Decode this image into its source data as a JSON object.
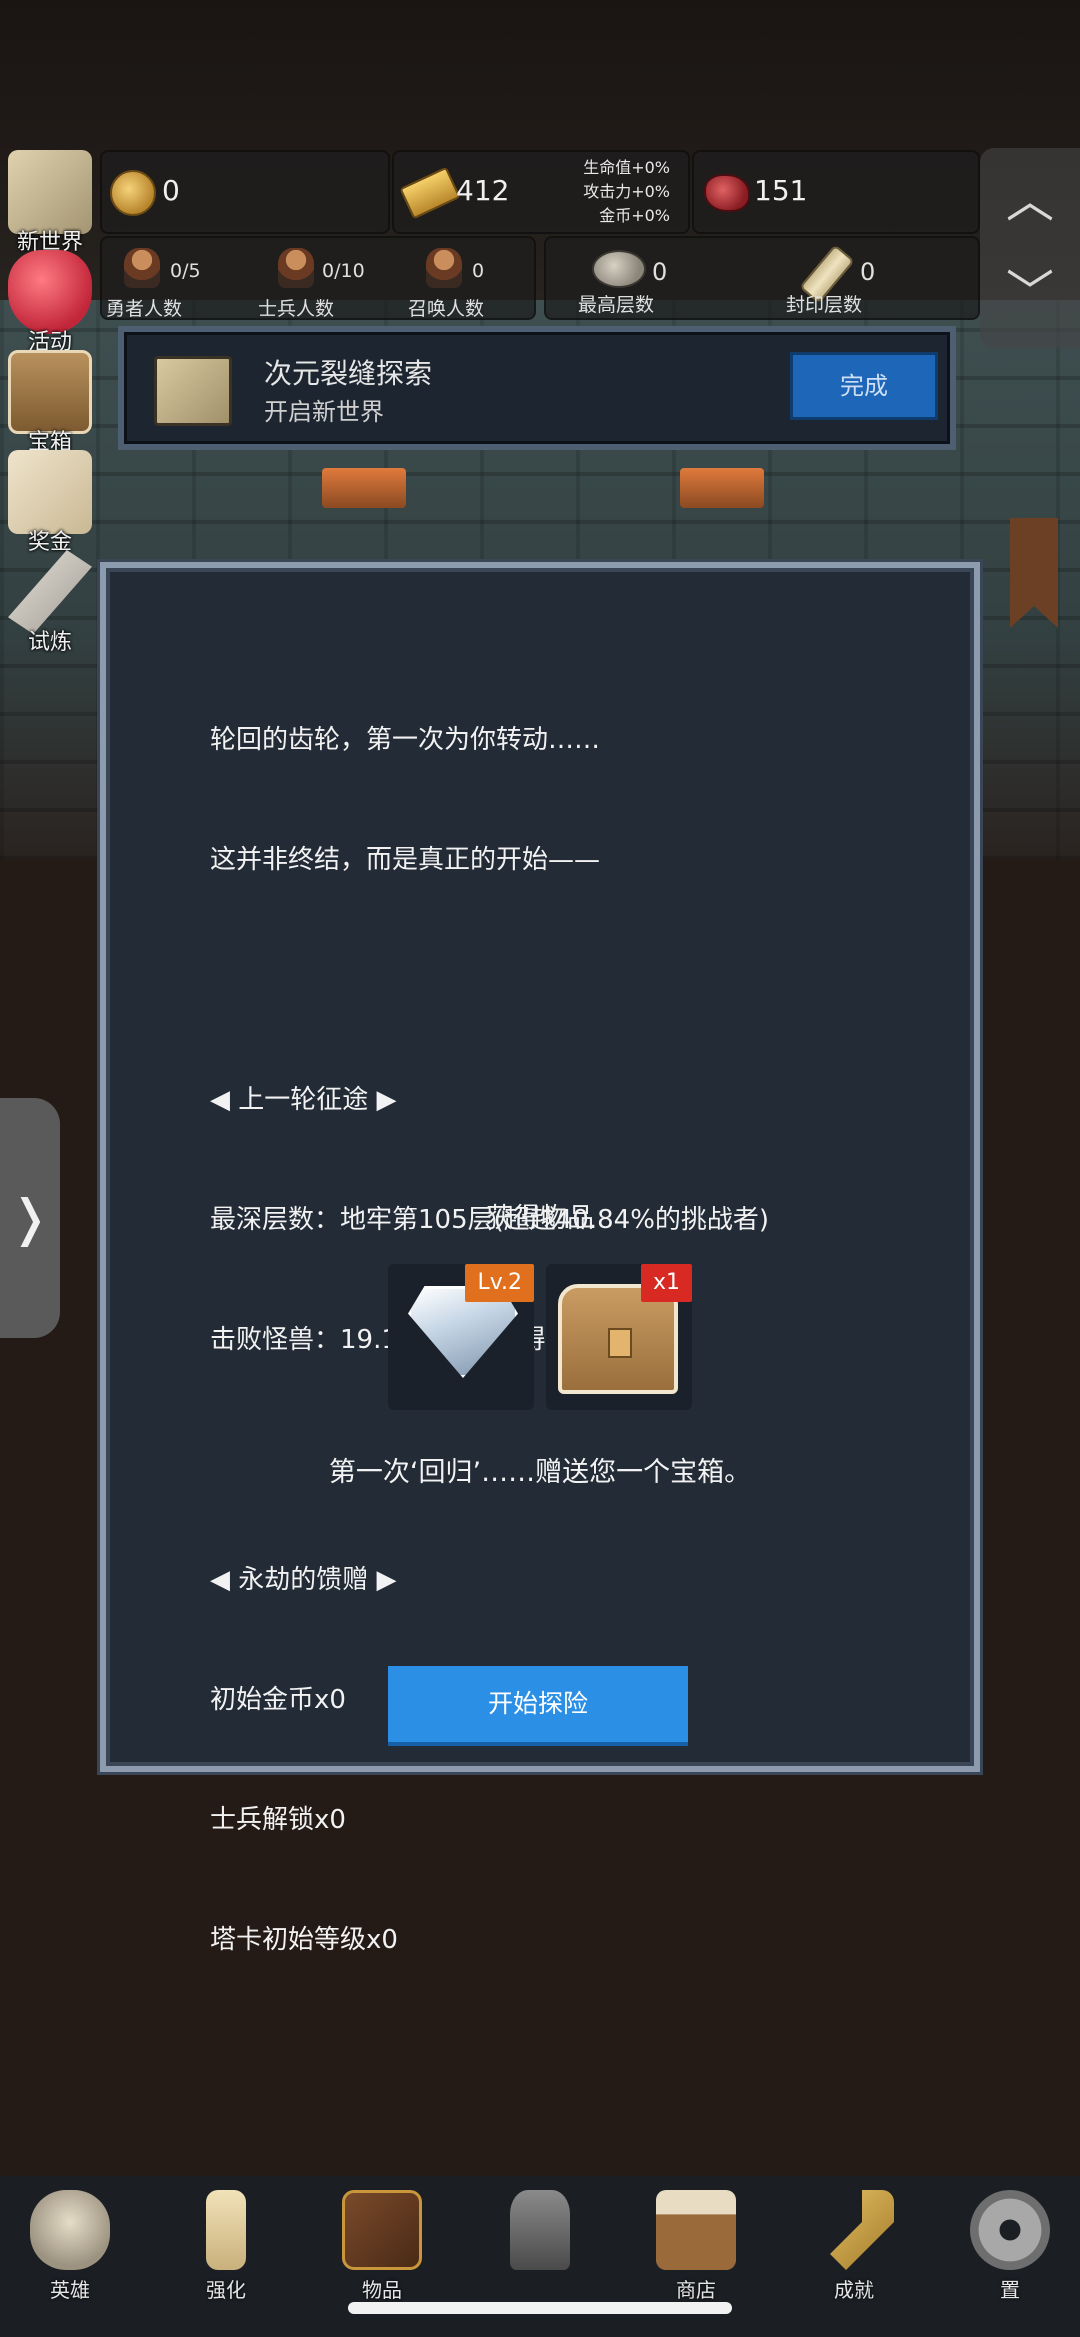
{
  "side_menu": [
    {
      "label": "新世界",
      "icon": "map-icon"
    },
    {
      "label": "活动",
      "icon": "heart-icon"
    },
    {
      "label": "宝箱",
      "icon": "chest-icon"
    },
    {
      "label": "奖金",
      "icon": "envelope-icon"
    },
    {
      "label": "试炼",
      "icon": "feather-icon"
    }
  ],
  "resources": {
    "coins": "0",
    "gold": "412",
    "gems": "151",
    "bonus_hp": "生命值+0%",
    "bonus_atk": "攻击力+0%",
    "bonus_coin": "金币+0%"
  },
  "counts": {
    "heroes_value": "0/5",
    "heroes_label": "勇者人数",
    "soldiers_value": "0/10",
    "soldiers_label": "士兵人数",
    "summon_value": "0",
    "summon_label": "召唤人数",
    "max_floor_value": "0",
    "max_floor_label": "最高层数",
    "sealed_floor_value": "0",
    "sealed_floor_label": "封印层数"
  },
  "quest": {
    "title": "次元裂缝探索",
    "subtitle": "开启新世界",
    "button": "完成"
  },
  "drawer": {
    "glyph": "❭"
  },
  "dialog": {
    "lines": [
      "轮回的齿轮，第一次为你转动……",
      "这并非终结，而是真正的开始——",
      "",
      "◀ 上一轮征途 ▶",
      "最深层数：地牢第105层(超越40.84%的挑战者)",
      "击败怪兽：19.17K(地板记得你的脸)",
      "",
      "◀ 永劫的馈赠 ▶",
      "初始金币x0",
      "士兵解锁x0",
      "塔卡初始等级x0"
    ],
    "items_title": "获得物品",
    "items": [
      {
        "icon": "diamond-icon",
        "badge": "Lv.2"
      },
      {
        "icon": "treasure-chest-icon",
        "badge": "x1"
      }
    ],
    "gift_text": "第一次‘回归’……赠送您一个宝箱。",
    "start_button": "开始探险"
  },
  "bottom_nav": [
    {
      "label": "英雄",
      "icon": "skull-icon"
    },
    {
      "label": "强化",
      "icon": "candle-icon"
    },
    {
      "label": "物品",
      "icon": "book-icon"
    },
    {
      "label": "",
      "icon": "lantern-icon"
    },
    {
      "label": "商店",
      "icon": "mug-icon"
    },
    {
      "label": "成就",
      "icon": "key-icon"
    },
    {
      "label": "置",
      "icon": "gear-icon"
    }
  ]
}
